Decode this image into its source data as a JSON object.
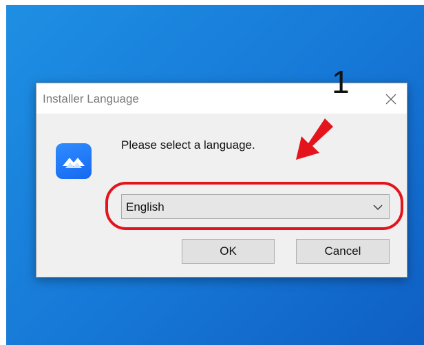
{
  "dialog": {
    "title": "Installer Language",
    "close_icon": "close-icon",
    "app_icon": "app-logo-icon",
    "prompt": "Please select a language.",
    "language_select": {
      "selected": "English",
      "chevron_icon": "chevron-down-icon"
    },
    "buttons": {
      "ok": "OK",
      "cancel": "Cancel"
    }
  },
  "annotations": {
    "step_number": "1",
    "arrow_icon": "arrow-pointer-icon",
    "highlight_color": "#e3141c"
  },
  "colors": {
    "desktop": "#1677d6",
    "dialog_background": "#f0f0f0",
    "app_icon": "#1668f0"
  }
}
